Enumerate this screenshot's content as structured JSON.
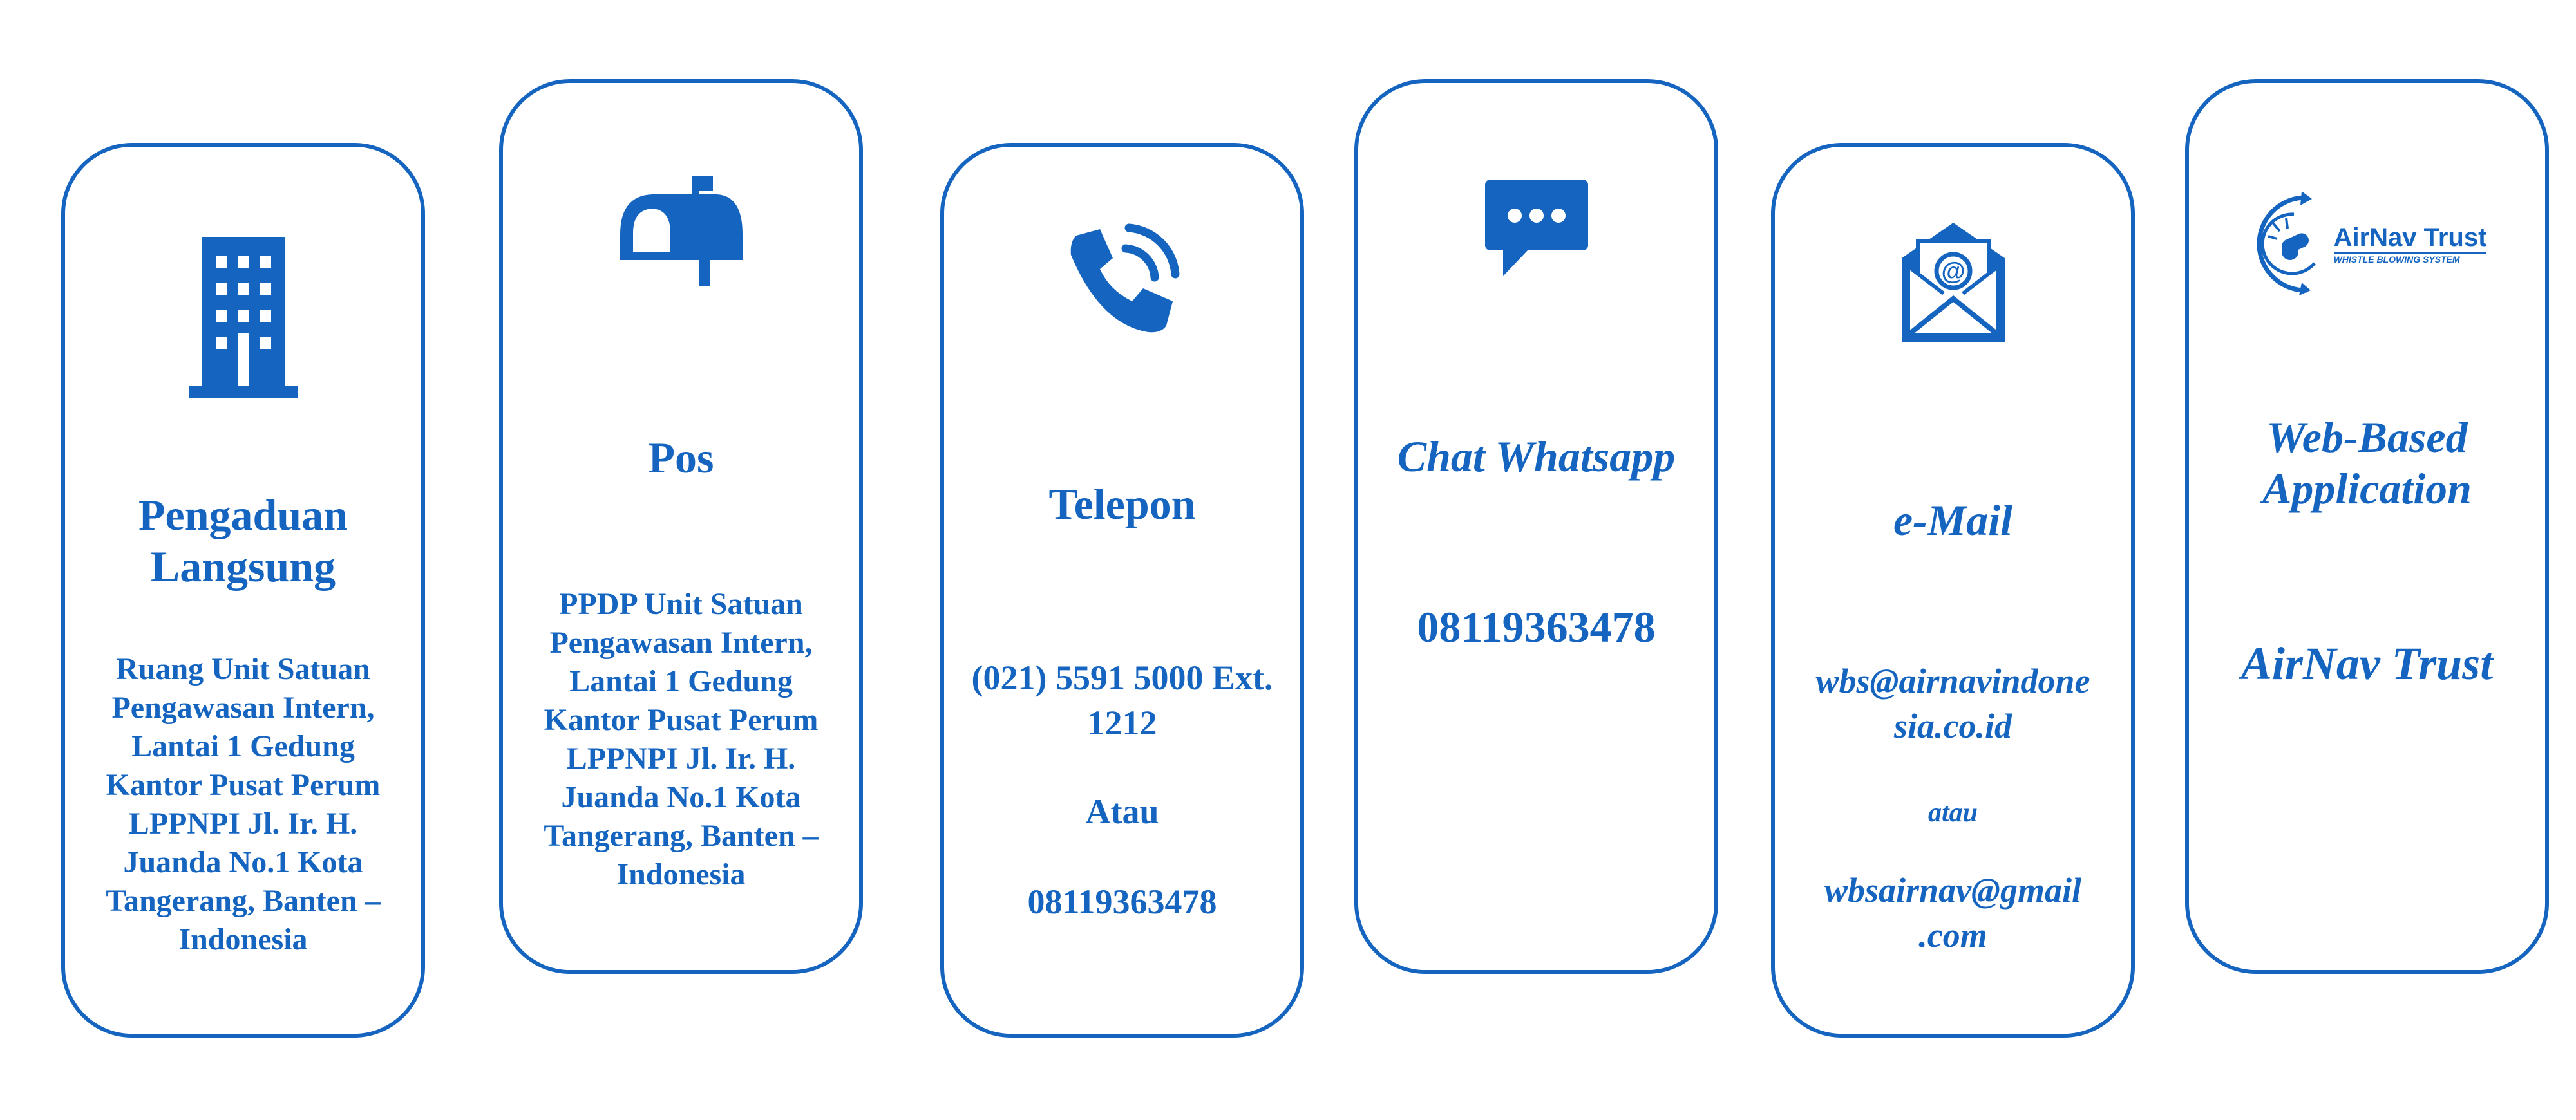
{
  "colors": {
    "accent": "#1565c0",
    "background": "#ffffff"
  },
  "cards": [
    {
      "icon": "building-icon",
      "title_line1": "Pengaduan",
      "title_line2": "Langsung",
      "body": [
        "Ruang Unit Satuan",
        "Pengawasan Intern,",
        "Lantai 1 Gedung",
        "Kantor Pusat Perum",
        "LPPNPI Jl. Ir. H.",
        "Juanda No.1 Kota",
        "Tangerang, Banten –",
        "Indonesia"
      ]
    },
    {
      "icon": "mailbox-icon",
      "title": "Pos",
      "body": [
        "PPDP Unit Satuan",
        "Pengawasan Intern,",
        "Lantai 1 Gedung",
        "Kantor Pusat Perum",
        "LPPNPI Jl. Ir. H.",
        "Juanda No.1 Kota",
        "Tangerang, Banten –",
        "Indonesia"
      ]
    },
    {
      "icon": "phone-icon",
      "title": "Telepon",
      "number1_line1": "(021) 5591 5000 Ext.",
      "number1_line2": "1212",
      "separator": "Atau",
      "number2": "08119363478"
    },
    {
      "icon": "chat-icon",
      "title": "Chat Whatsapp",
      "number": "08119363478"
    },
    {
      "icon": "envelope-icon",
      "title": "e-Mail",
      "email1_line1": "wbs@airnavindone",
      "email1_line2": "sia.co.id",
      "separator": "atau",
      "email2_line1": "wbsairnav@gmail",
      "email2_line2": ".com"
    },
    {
      "icon": "airnav-trust-logo",
      "logo_text": "AirNav Trust",
      "logo_subtext": "WHISTLE BLOWING SYSTEM",
      "title_line1": "Web-Based",
      "title_line2": "Application",
      "name": "AirNav Trust"
    }
  ]
}
